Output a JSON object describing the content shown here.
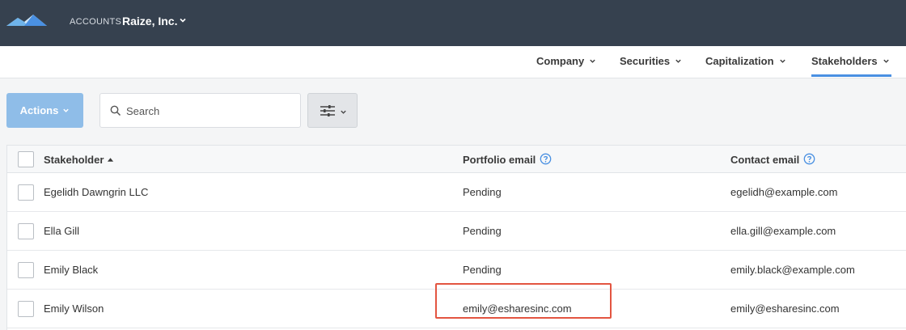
{
  "header": {
    "accounts_label": "ACCOUNTS",
    "company_name": "Raize, Inc."
  },
  "nav": {
    "items": [
      {
        "label": "Company"
      },
      {
        "label": "Securities"
      },
      {
        "label": "Capitalization"
      },
      {
        "label": "Stakeholders",
        "active": true
      }
    ]
  },
  "toolbar": {
    "actions_label": "Actions",
    "search_placeholder": "Search"
  },
  "table": {
    "columns": [
      "Stakeholder",
      "Portfolio email",
      "Contact email"
    ],
    "rows": [
      {
        "name": "Egelidh Dawngrin LLC",
        "portfolio_email": "Pending",
        "contact_email": "egelidh@example.com"
      },
      {
        "name": "Ella Gill",
        "portfolio_email": "Pending",
        "contact_email": "ella.gill@example.com"
      },
      {
        "name": "Emily Black",
        "portfolio_email": "Pending",
        "contact_email": "emily.black@example.com"
      },
      {
        "name": "Emily Wilson",
        "portfolio_email": "emily@esharesinc.com",
        "contact_email": "emily@esharesinc.com"
      }
    ]
  },
  "colors": {
    "topbar": "#36414f",
    "accent": "#4a90e2",
    "actions_button": "#8fbde8",
    "highlight": "#e35541"
  },
  "icons": [
    "logo-mountains-icon",
    "chevron-down-icon",
    "search-icon",
    "filter-sliders-icon",
    "sort-ascending-icon",
    "help-circle-icon"
  ]
}
